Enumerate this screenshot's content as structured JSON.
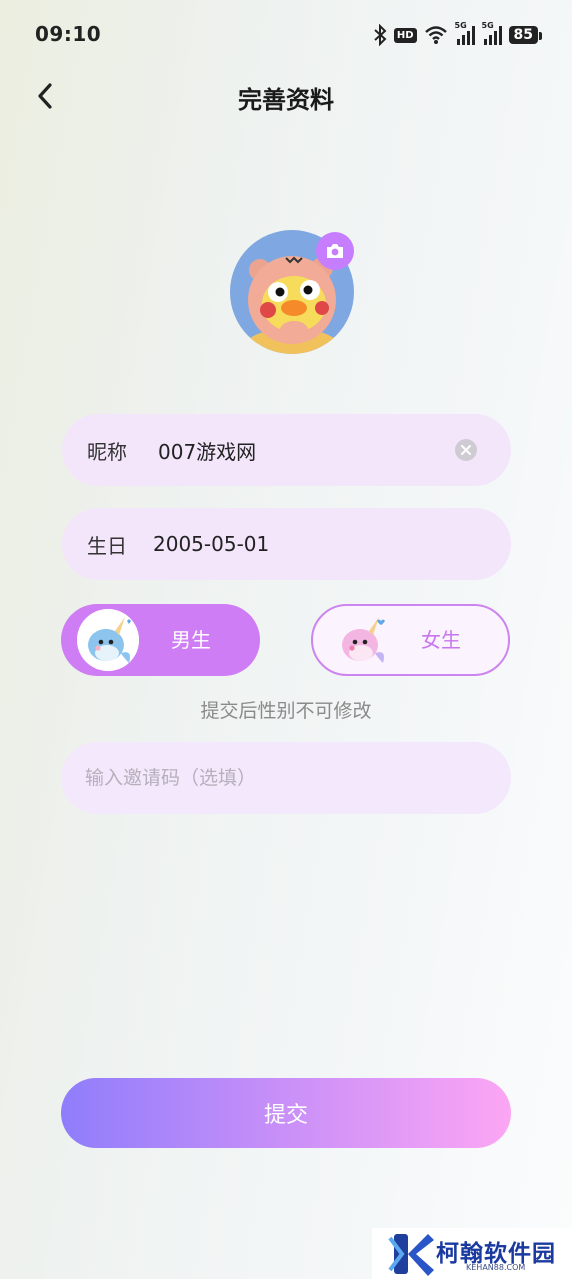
{
  "status_bar": {
    "time": "09:10",
    "hd_label": "HD",
    "sim1_label": "5G",
    "sim2_label": "5G",
    "battery": "85",
    "icons": [
      "bluetooth-icon",
      "hd-icon",
      "wifi-icon",
      "signal-5g-icon",
      "signal-5g-icon",
      "battery-icon"
    ]
  },
  "header": {
    "title": "完善资料",
    "back_icon": "chevron-left-icon"
  },
  "avatar": {
    "camera_icon": "camera-icon"
  },
  "form": {
    "nickname_label": "昵称",
    "nickname_value": "007游戏网",
    "birthday_label": "生日",
    "birthday_value": "2005-05-01",
    "male_label": "男生",
    "female_label": "女生",
    "gender_selected": "男生",
    "gender_note": "提交后性别不可修改",
    "invite_placeholder": "输入邀请码（选填）"
  },
  "submit_label": "提交",
  "watermark": {
    "name": "柯翰软件园",
    "domain": "KEHAN88.COM"
  },
  "colors": {
    "accent_purple": "#cf7df5",
    "field_bg": "#f3e6fb",
    "submit_start": "#8f7dfb",
    "submit_end": "#fca6f4"
  }
}
